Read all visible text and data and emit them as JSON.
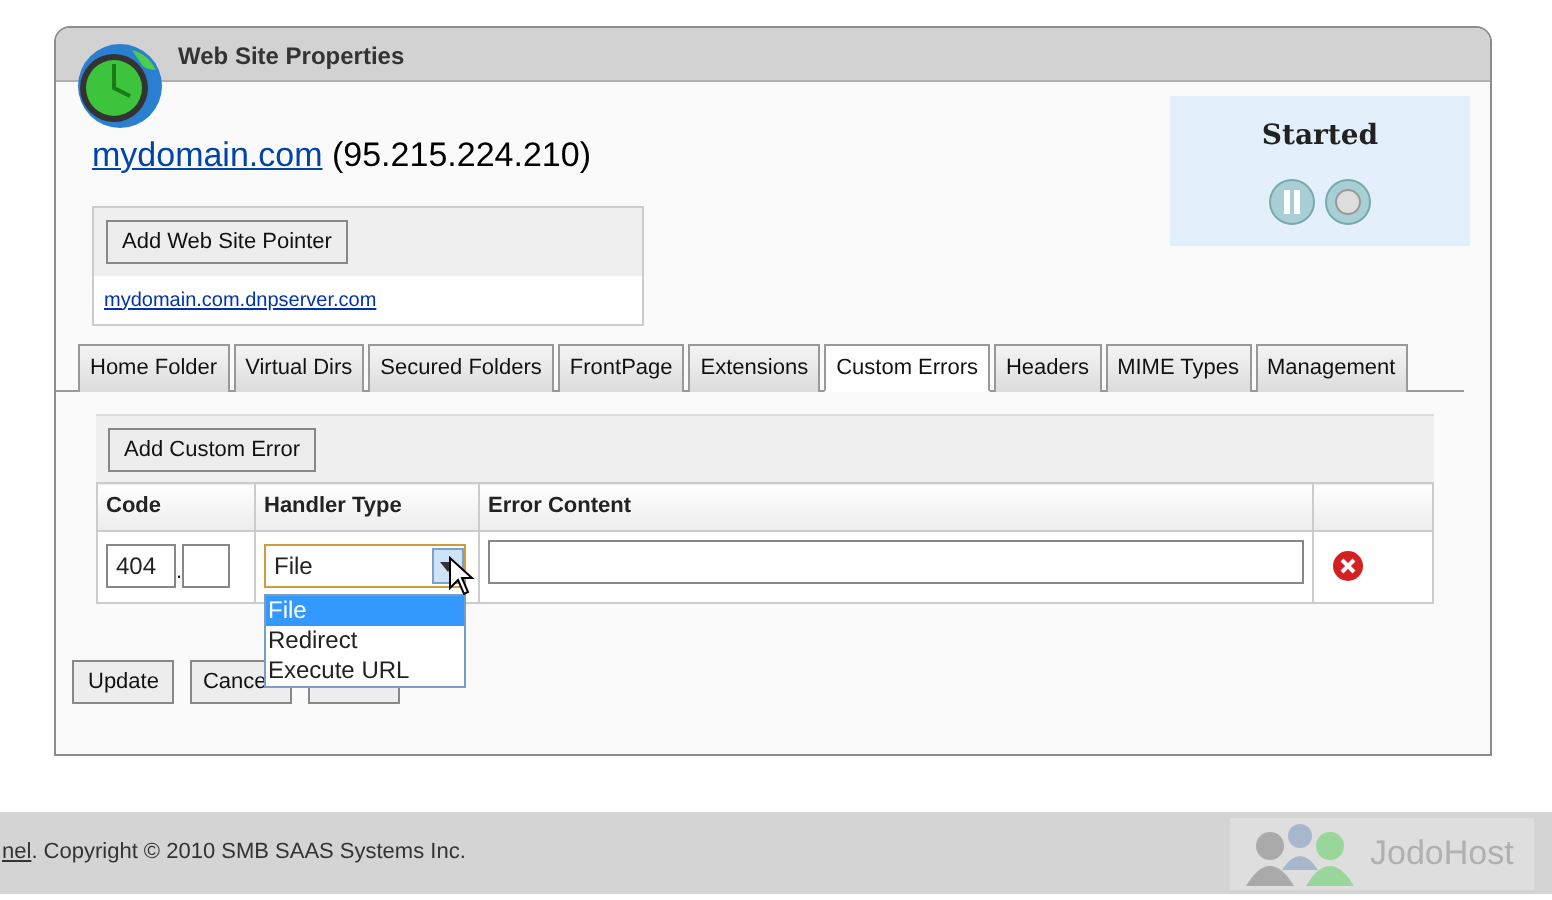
{
  "window": {
    "title": "Web Site Properties"
  },
  "site": {
    "domain": "mydomain.com",
    "ip": "(95.215.224.210)"
  },
  "pointers": {
    "button": "Add Web Site Pointer",
    "items": [
      "mydomain.com.dnpserver.com"
    ]
  },
  "status": {
    "label": "Started"
  },
  "tabs": [
    {
      "label": "Home Folder",
      "selected": false
    },
    {
      "label": "Virtual Dirs",
      "selected": false
    },
    {
      "label": "Secured Folders",
      "selected": false
    },
    {
      "label": "FrontPage",
      "selected": false
    },
    {
      "label": "Extensions",
      "selected": false
    },
    {
      "label": "Custom Errors",
      "selected": true
    },
    {
      "label": "Headers",
      "selected": false
    },
    {
      "label": "MIME Types",
      "selected": false
    },
    {
      "label": "Management",
      "selected": false
    }
  ],
  "custom_errors": {
    "button": "Add Custom Error",
    "columns": [
      "Code",
      "Handler Type",
      "Error Content"
    ],
    "rows": [
      {
        "code": "404",
        "separator": ".",
        "handler": "File"
      }
    ]
  },
  "dropdown": {
    "options": [
      {
        "label": "File",
        "selected": true
      },
      {
        "label": "Redirect",
        "selected": false
      },
      {
        "label": "Execute URL",
        "selected": false
      }
    ]
  },
  "buttons": [
    "Update",
    "Cance"
  ],
  "footer": {
    "link": "nel",
    "text": ". Copyright © 2010 SMB SAAS Systems Inc.",
    "logo": "JodoHost"
  }
}
